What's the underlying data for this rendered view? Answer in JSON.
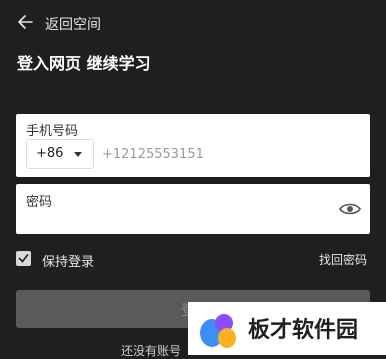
{
  "header": {
    "back_label": "返回空间",
    "back_icon": "arrow-left-icon"
  },
  "title": "登入网页 继续学习",
  "phone": {
    "caption": "手机号码",
    "country_code": "+86",
    "placeholder": "+12125553151"
  },
  "password": {
    "caption": "密码",
    "placeholder": "",
    "toggle_icon": "eye-icon"
  },
  "remember": {
    "label": "保持登录",
    "checked": true
  },
  "forgot_label": "找回密码",
  "login_label": "登录",
  "register_text": "还没有账号",
  "watermark": {
    "text": "板才软件园"
  },
  "colors": {
    "background": "#1f1f1f",
    "field_background": "#ffffff",
    "button_disabled": "#5a5a5a"
  }
}
